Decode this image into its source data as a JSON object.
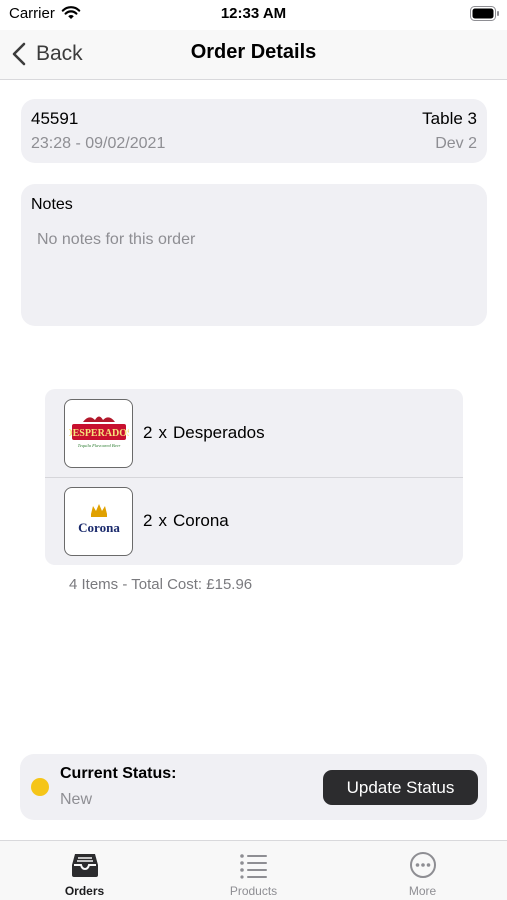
{
  "status_bar": {
    "carrier": "Carrier",
    "time": "12:33 AM"
  },
  "nav": {
    "back_label": "Back",
    "title": "Order Details"
  },
  "order": {
    "id": "45591",
    "table": "Table 3",
    "datetime": "23:28 - 09/02/2021",
    "device": "Dev 2"
  },
  "notes": {
    "title": "Notes",
    "text": "No notes for this order"
  },
  "items": [
    {
      "quantity": "2",
      "times": "x",
      "name": "Desperados",
      "logo_text": "DESPERADOS",
      "logo_subtext": "Tequila Flavoured Beer",
      "icon": "desperados-logo"
    },
    {
      "quantity": "2",
      "times": "x",
      "name": "Corona",
      "logo_text": "Corona",
      "icon": "corona-logo"
    }
  ],
  "summary": "4 Items - Total Cost: £15.96",
  "status": {
    "label": "Current Status:",
    "value": "New",
    "dot_color": "#f5c518",
    "button_label": "Update Status"
  },
  "tabs": [
    {
      "label": "Orders",
      "icon": "tray-icon",
      "active": true
    },
    {
      "label": "Products",
      "icon": "list-icon",
      "active": false
    },
    {
      "label": "More",
      "icon": "ellipsis-circle-icon",
      "active": false
    }
  ]
}
